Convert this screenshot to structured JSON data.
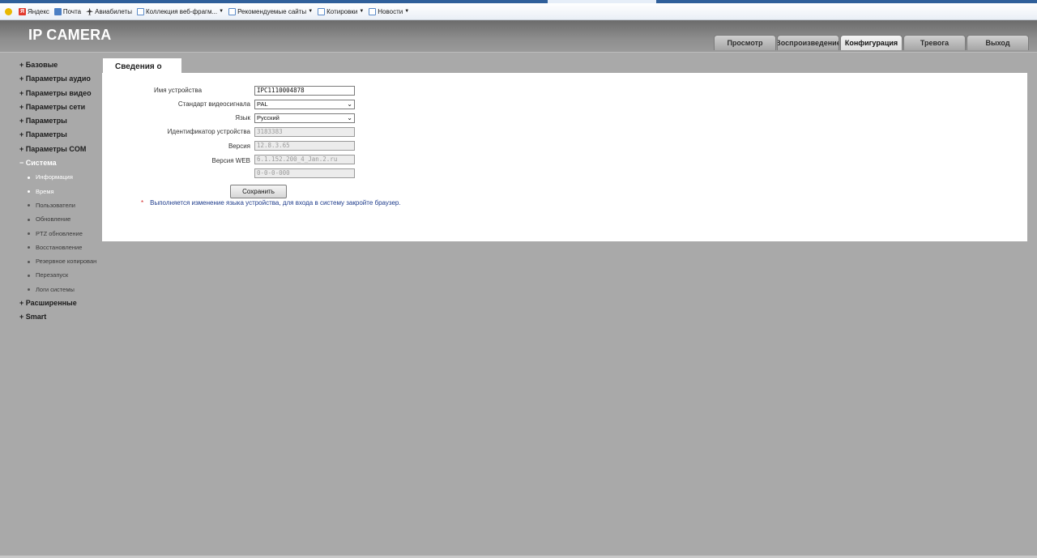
{
  "favorites": [
    {
      "icon": "yandex-icon",
      "label": "Яндекс",
      "dropdown": false
    },
    {
      "icon": "mail-icon",
      "label": "Почта",
      "dropdown": false
    },
    {
      "icon": "plane-icon",
      "label": "Авиабилеты",
      "dropdown": false
    },
    {
      "icon": "page-icon",
      "label": "Коллекция веб-фрагм...",
      "dropdown": true
    },
    {
      "icon": "page-icon",
      "label": "Рекомендуемые сайты",
      "dropdown": true
    },
    {
      "icon": "page-icon",
      "label": "Котировки",
      "dropdown": true
    },
    {
      "icon": "page-icon",
      "label": "Новости",
      "dropdown": true
    }
  ],
  "header": {
    "logo": "IP CAMERA",
    "tabs": [
      {
        "label": "Просмотр",
        "active": false
      },
      {
        "label": "Воспроизведение",
        "active": false
      },
      {
        "label": "Конфигурация",
        "active": true
      },
      {
        "label": "Тревога",
        "active": false
      },
      {
        "label": "Выход",
        "active": false
      }
    ]
  },
  "sidebar": {
    "groups": [
      {
        "label": "+ Базовые",
        "open": false
      },
      {
        "label": "+ Параметры аудио",
        "open": false
      },
      {
        "label": "+ Параметры видео",
        "open": false
      },
      {
        "label": "+ Параметры сети",
        "open": false
      },
      {
        "label": "+ Параметры",
        "open": false
      },
      {
        "label": "+ Параметры",
        "open": false
      },
      {
        "label": "+ Параметры COM",
        "open": false
      },
      {
        "label": "− Система",
        "open": true,
        "items": [
          {
            "label": "Информация",
            "active": true
          },
          {
            "label": "Время",
            "active": true
          },
          {
            "label": "Пользователи",
            "active": false
          },
          {
            "label": "Обновление",
            "active": false
          },
          {
            "label": "PTZ обновление",
            "active": false
          },
          {
            "label": "Восстановление",
            "active": false
          },
          {
            "label": "Резервное копирован",
            "active": false
          },
          {
            "label": "Перезапуск",
            "active": false
          },
          {
            "label": "Логи системы",
            "active": false
          }
        ]
      },
      {
        "label": "+ Расширенные",
        "open": false
      },
      {
        "label": "+ Smart",
        "open": false
      }
    ]
  },
  "content": {
    "tab_title": "Сведения о",
    "fields": {
      "device_name": {
        "label": "Имя устройства",
        "value": "IPC1110004878"
      },
      "video_standard": {
        "label": "Стандарт видеосигнала",
        "value": "PAL"
      },
      "language": {
        "label": "Язык",
        "value": "Русский"
      },
      "device_id": {
        "label": "Идентификатор устройства",
        "value": "3183383"
      },
      "version": {
        "label": "Версия",
        "value": "12.8.3.65"
      },
      "web_version": {
        "label": "Версия WEB",
        "value": "6.1.152.200_4_Jan.2.ru"
      },
      "extra": {
        "value": "0-0-0-000"
      }
    },
    "save_label": "Сохранить",
    "note_star": "*",
    "note": "Выполняется изменение языка устройства, для входа в систему закройте браузер."
  }
}
